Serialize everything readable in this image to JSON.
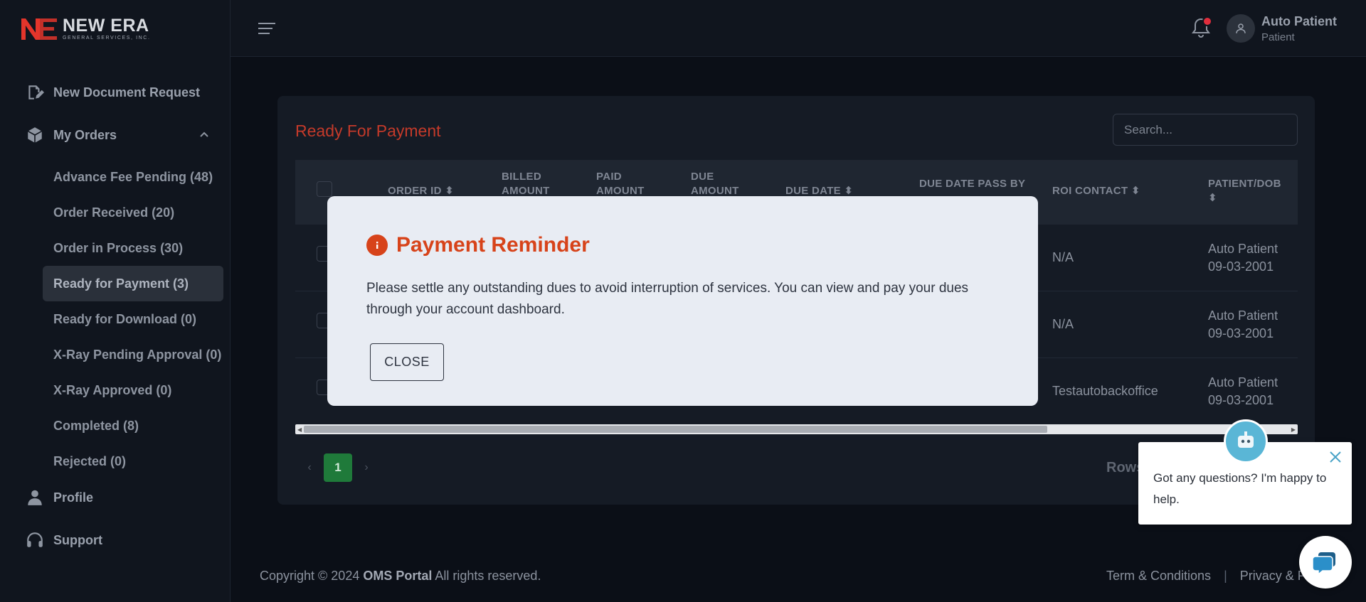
{
  "brand": {
    "title": "NEW ERA",
    "subtitle": "GENERAL SERVICES, INC.",
    "accent": "#e3352b"
  },
  "sidebar": {
    "items": [
      {
        "label": "New Document Request",
        "icon": "document-edit-icon"
      },
      {
        "label": "My Orders",
        "icon": "box-icon"
      },
      {
        "label": "Profile",
        "icon": "user-icon"
      },
      {
        "label": "Support",
        "icon": "headset-icon"
      }
    ],
    "orders": [
      {
        "label": "Advance Fee Pending (48)"
      },
      {
        "label": "Order Received (20)"
      },
      {
        "label": "Order in Process (30)"
      },
      {
        "label": "Ready for Payment (3)",
        "active": true
      },
      {
        "label": "Ready for Download (0)"
      },
      {
        "label": "X-Ray Pending Approval (0)"
      },
      {
        "label": "X-Ray Approved (0)"
      },
      {
        "label": "Completed (8)"
      },
      {
        "label": "Rejected (0)"
      }
    ]
  },
  "header": {
    "user_name": "Auto Patient",
    "user_role": "Patient"
  },
  "main": {
    "title": "Ready For Payment",
    "search_placeholder": "Search...",
    "columns": {
      "order_id": "ORDER ID",
      "billed": "BILLED AMOUNT",
      "paid": "PAID AMOUNT",
      "due": "DUE AMOUNT",
      "due_date": "DUE DATE",
      "due_pass": "DUE DATE PASS BY",
      "roi": "ROI CONTACT",
      "patient": "PATIENT/DOB"
    },
    "rows": [
      {
        "roi": "N/A",
        "patient": "Auto Patient",
        "dob": "09-03-2001"
      },
      {
        "roi": "N/A",
        "patient": "Auto Patient",
        "dob": "09-03-2001"
      },
      {
        "roi": "Testautobackoffice",
        "patient": "Auto Patient",
        "dob": "09-03-2001"
      }
    ],
    "page": "1",
    "rows_label": "Rows"
  },
  "footer": {
    "copyright_prefix": "Copyright © 2024",
    "portal": "OMS Portal",
    "rights": "All rights reserved.",
    "terms": "Term & Conditions",
    "privacy": "Privacy & P"
  },
  "modal": {
    "title": "Payment Reminder",
    "body": "Please settle any outstanding dues to avoid interruption of services. You can view and pay your dues through your account dashboard.",
    "close_label": "CLOSE",
    "accent": "#d7431a"
  },
  "chat": {
    "message": "Got any questions? I'm happy to help."
  }
}
